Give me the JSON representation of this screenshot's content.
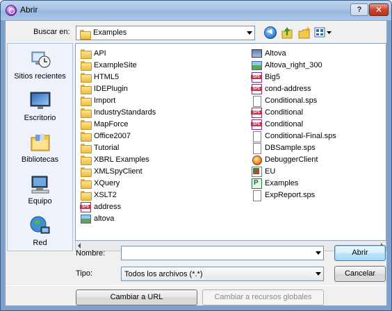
{
  "window": {
    "title": "Abrir",
    "help_label": "?",
    "close_label": "✕"
  },
  "toolbar": {
    "lookin_label": "Buscar en:",
    "lookin_value": "Examples",
    "icons": [
      "back-icon",
      "up-folder-icon",
      "new-folder-icon",
      "views-menu-icon"
    ]
  },
  "places": [
    {
      "label": "Sitios recientes",
      "icon": "recent-places-icon"
    },
    {
      "label": "Escritorio",
      "icon": "desktop-icon"
    },
    {
      "label": "Bibliotecas",
      "icon": "libraries-icon"
    },
    {
      "label": "Equipo",
      "icon": "computer-icon"
    },
    {
      "label": "Red",
      "icon": "network-icon"
    }
  ],
  "files_col1": [
    {
      "name": "API",
      "icon": "folder"
    },
    {
      "name": "ExampleSite",
      "icon": "folder"
    },
    {
      "name": "HTML5",
      "icon": "folder"
    },
    {
      "name": "IDEPlugin",
      "icon": "folder"
    },
    {
      "name": "Import",
      "icon": "folder"
    },
    {
      "name": "IndustryStandards",
      "icon": "folder"
    },
    {
      "name": "MapForce",
      "icon": "folder"
    },
    {
      "name": "Office2007",
      "icon": "folder"
    },
    {
      "name": "Tutorial",
      "icon": "folder"
    },
    {
      "name": "XBRL Examples",
      "icon": "folder"
    },
    {
      "name": "XMLSpyClient",
      "icon": "folder"
    },
    {
      "name": "XQuery",
      "icon": "folder"
    },
    {
      "name": "XSLT2",
      "icon": "folder"
    },
    {
      "name": "address",
      "icon": "sps"
    },
    {
      "name": "altova",
      "icon": "image"
    }
  ],
  "files_col2": [
    {
      "name": "Altova",
      "icon": "desktop-shortcut"
    },
    {
      "name": "Altova_right_300",
      "icon": "image"
    },
    {
      "name": "Big5",
      "icon": "sps"
    },
    {
      "name": "cond-address",
      "icon": "sps"
    },
    {
      "name": "Conditional.sps",
      "icon": "doc"
    },
    {
      "name": "Conditional",
      "icon": "sps"
    },
    {
      "name": "Conditional",
      "icon": "sps"
    },
    {
      "name": "Conditional-Final.sps",
      "icon": "doc"
    },
    {
      "name": "DBSample.sps",
      "icon": "doc"
    },
    {
      "name": "DebuggerClient",
      "icon": "exe"
    },
    {
      "name": "EU",
      "icon": "app"
    },
    {
      "name": "Examples",
      "icon": "project"
    },
    {
      "name": "ExpReport.sps",
      "icon": "doc"
    }
  ],
  "form": {
    "name_label": "Nombre:",
    "name_value": "",
    "type_label": "Tipo:",
    "type_value": "Todos los archivos (*.*)",
    "open_label": "Abrir",
    "cancel_label": "Cancelar",
    "url_label": "Cambiar a URL",
    "global_label": "Cambiar a recursos globales"
  }
}
